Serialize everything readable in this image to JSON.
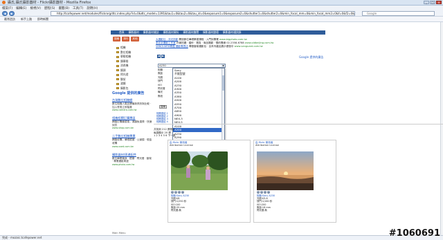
{
  "window": {
    "title": "攝氏,攝氏攝影器材 - Flickr攝影器材 - Mozilla Firefox",
    "buttons": [
      "_",
      "□",
      "x"
    ]
  },
  "menu": [
    "檔案(F)",
    "編輯(E)",
    "檢視(V)",
    "歷程(S)",
    "書籤(B)",
    "工具(T)",
    "說明(H)"
  ],
  "nav": {
    "url": "http://tcafepower.net/modules/flickrorg/dtc.index.php?id=0&dtc_model=1391&tau1=0&tau2=0&tau_id=0&exposure1=0&exposure2=0&shutter1=0&shutter2=0&min_focal_mm=0&min_focal_mm2=0&f=0&f2=0&f3",
    "search_placeholder": "Google",
    "back": "◀",
    "forward": "▶"
  },
  "bookmarks": [
    "最常造訪",
    "新手上路",
    "即時新聞"
  ],
  "topnav": [
    "首頁",
    "攝影器材",
    "攝影器材雜誌",
    "攝影器材資料",
    "攝影器材趣聞",
    "攝影器材論壇",
    "攝影器材通訊錄"
  ],
  "cat_buttons": [
    "搜尋",
    "排行",
    "其他"
  ],
  "categories": [
    "相機",
    "數位相機",
    "單眼相機",
    "類單眼",
    "消費機",
    "鏡頭",
    "閃光燈",
    "腳架",
    "濾鏡",
    "攝影包",
    "記憶卡",
    "電池",
    "印表機"
  ],
  "google_label": "Google 提供的廣告",
  "side_ads": [
    {
      "title": "台灣數位相機網",
      "body": "數位相機人氣品牌最新資訊與比較 · 加入會員立即抽獎",
      "url": "www.camera.com.tw"
    },
    {
      "title": "相機相關訂購專區",
      "body": "網路訂購最優惠，滿額免運費 · 快速到貨",
      "url": "www.shop.com.tw"
    },
    {
      "title": "二手數位相機專賣",
      "body": "網路收購，單眼鏡頭 · 公道價 · 現金收購",
      "url": "www.used.com.tw"
    },
    {
      "title": "攝影器材/周邊配件",
      "body": "數位單眼機身 · 鏡頭 · 閃光燈 · 腳架 · 專業攝影周邊",
      "url": "www.photo.com.tw"
    }
  ],
  "main_ads": [
    {
      "title": "大攝影社 - 浮光掠影",
      "body": "開放數位單眼學習課程 · 入門到專業",
      "url": "www.bigphoto.com.tw"
    },
    {
      "title": "老北京攝影工作室",
      "body": "外景拍攝 · 婚紗 · 寫真 · 商品攝影 · 預約專線 02-2358-6788",
      "url": "www.oldbeijing.com.tw"
    },
    {
      "title": "VANGUARD精嘉 攝影專賣店",
      "body": "專營腳架攝影包 · 全系列產品展示優惠中",
      "url": "www.vanguard.com.tw"
    }
  ],
  "google_badge": "Google 提供的廣告",
  "filter_form": {
    "selected": "A230",
    "labels": [
      "相機",
      "焦距",
      "光圈",
      "快門",
      "ISO",
      "閃光燈",
      "曝光",
      "焦段",
      "",
      "",
      "",
      "",
      "",
      "",
      "排序"
    ],
    "go_label": "搜尋"
  },
  "dropdown_options": [
    "Sony",
    "不限型號",
    "A100",
    "A200",
    "A230",
    "A300",
    "A350",
    "A380",
    "A500",
    "A550",
    "A700",
    "A850",
    "A900",
    "NEX-3",
    "NEX-5",
    "A100",
    "A200",
    "A230",
    "A290",
    "A300",
    "A33",
    "A350",
    "A380",
    "A390",
    "A450",
    "A500",
    "A55",
    "A550",
    "A580",
    "A560",
    "A700",
    "A850",
    "A900",
    "DSLR"
  ],
  "dropdown_selected_index": 16,
  "side_links": [
    "相關連結 1",
    "相關連結 2",
    "相關連結 3",
    "相關連結 4"
  ],
  "results_info": [
    "共找到 212 張照片",
    "每頁顯示 20 張",
    "1 2 3 4 5 6 下一頁"
  ],
  "cards": [
    {
      "user": "由 flickr 使用者",
      "license": "Attribution License",
      "meta": [
        "相機:Sony A230",
        "光圈:f/8",
        "快門:1/250 秒",
        "ISO:100",
        "焦距:35 mm",
        "閃光燈:無"
      ]
    },
    {
      "user": "由 flickr 使用者",
      "license": "Attribution License",
      "meta": [
        "相機:Sony A230",
        "光圈:f/5.6",
        "快門:1/160 秒",
        "ISO:200",
        "焦距:18 mm",
        "閃光燈:無"
      ]
    }
  ],
  "bottom_label": "Main Menu",
  "status_text": "完成 - mozaic.tcafepower.net",
  "watermark": "#1060691"
}
